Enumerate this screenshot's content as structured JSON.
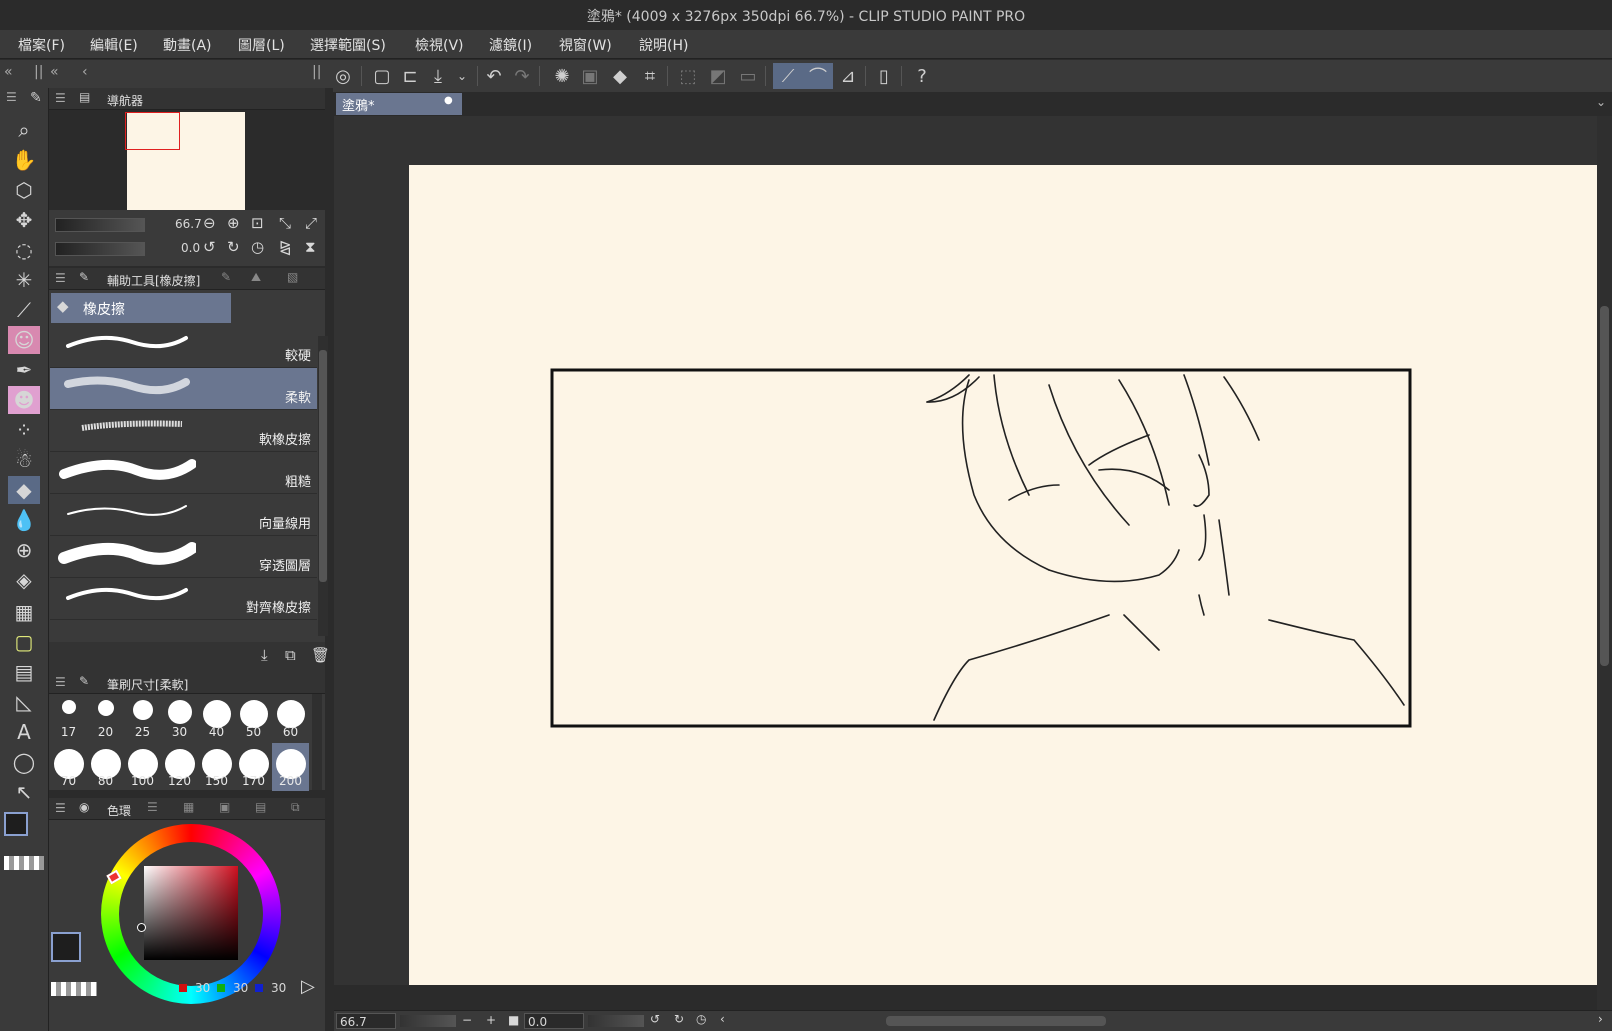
{
  "window": {
    "title": "塗鴉* (4009 x 3276px 350dpi 66.7%)  - CLIP STUDIO PAINT PRO"
  },
  "menu": [
    {
      "label": "檔案(F)"
    },
    {
      "label": "編輯(E)"
    },
    {
      "label": "動畫(A)"
    },
    {
      "label": "圖層(L)"
    },
    {
      "label": "選擇範圍(S)"
    },
    {
      "label": "檢視(V)"
    },
    {
      "label": "濾鏡(I)"
    },
    {
      "label": "視窗(W)"
    },
    {
      "label": "說明(H)"
    }
  ],
  "document_tab": {
    "label": "塗鴉*"
  },
  "navigator": {
    "title": "導航器",
    "zoom": "66.7",
    "rotation": "0.0"
  },
  "subtool": {
    "title": "輔助工具[橡皮擦]",
    "group": "橡皮擦",
    "brushes": [
      {
        "label": "較硬"
      },
      {
        "label": "柔軟"
      },
      {
        "label": "軟橡皮擦"
      },
      {
        "label": "粗糙"
      },
      {
        "label": "向量線用"
      },
      {
        "label": "穿透圖層"
      },
      {
        "label": "對齊橡皮擦"
      }
    ],
    "selected": "柔軟"
  },
  "brush_size": {
    "title": "筆刷尺寸[柔軟]",
    "sizes": [
      "17",
      "20",
      "25",
      "30",
      "40",
      "50",
      "60",
      "70",
      "80",
      "100",
      "120",
      "150",
      "170",
      "200"
    ],
    "selected": "200"
  },
  "color": {
    "title": "色環",
    "r": "30",
    "g": "30",
    "b": "30",
    "main": "#1e1e1e",
    "sub": "#fdf5e6",
    "paper": "#fdf5e6"
  },
  "status": {
    "zoom": "66.7",
    "rotation": "0.0"
  },
  "icons": [
    "search-icon",
    "hand-icon",
    "move-icon",
    "lasso-icon",
    "wand-icon",
    "eyedropper-icon",
    "pen-icon",
    "eraser-icon",
    "fill-icon",
    "text-icon"
  ]
}
